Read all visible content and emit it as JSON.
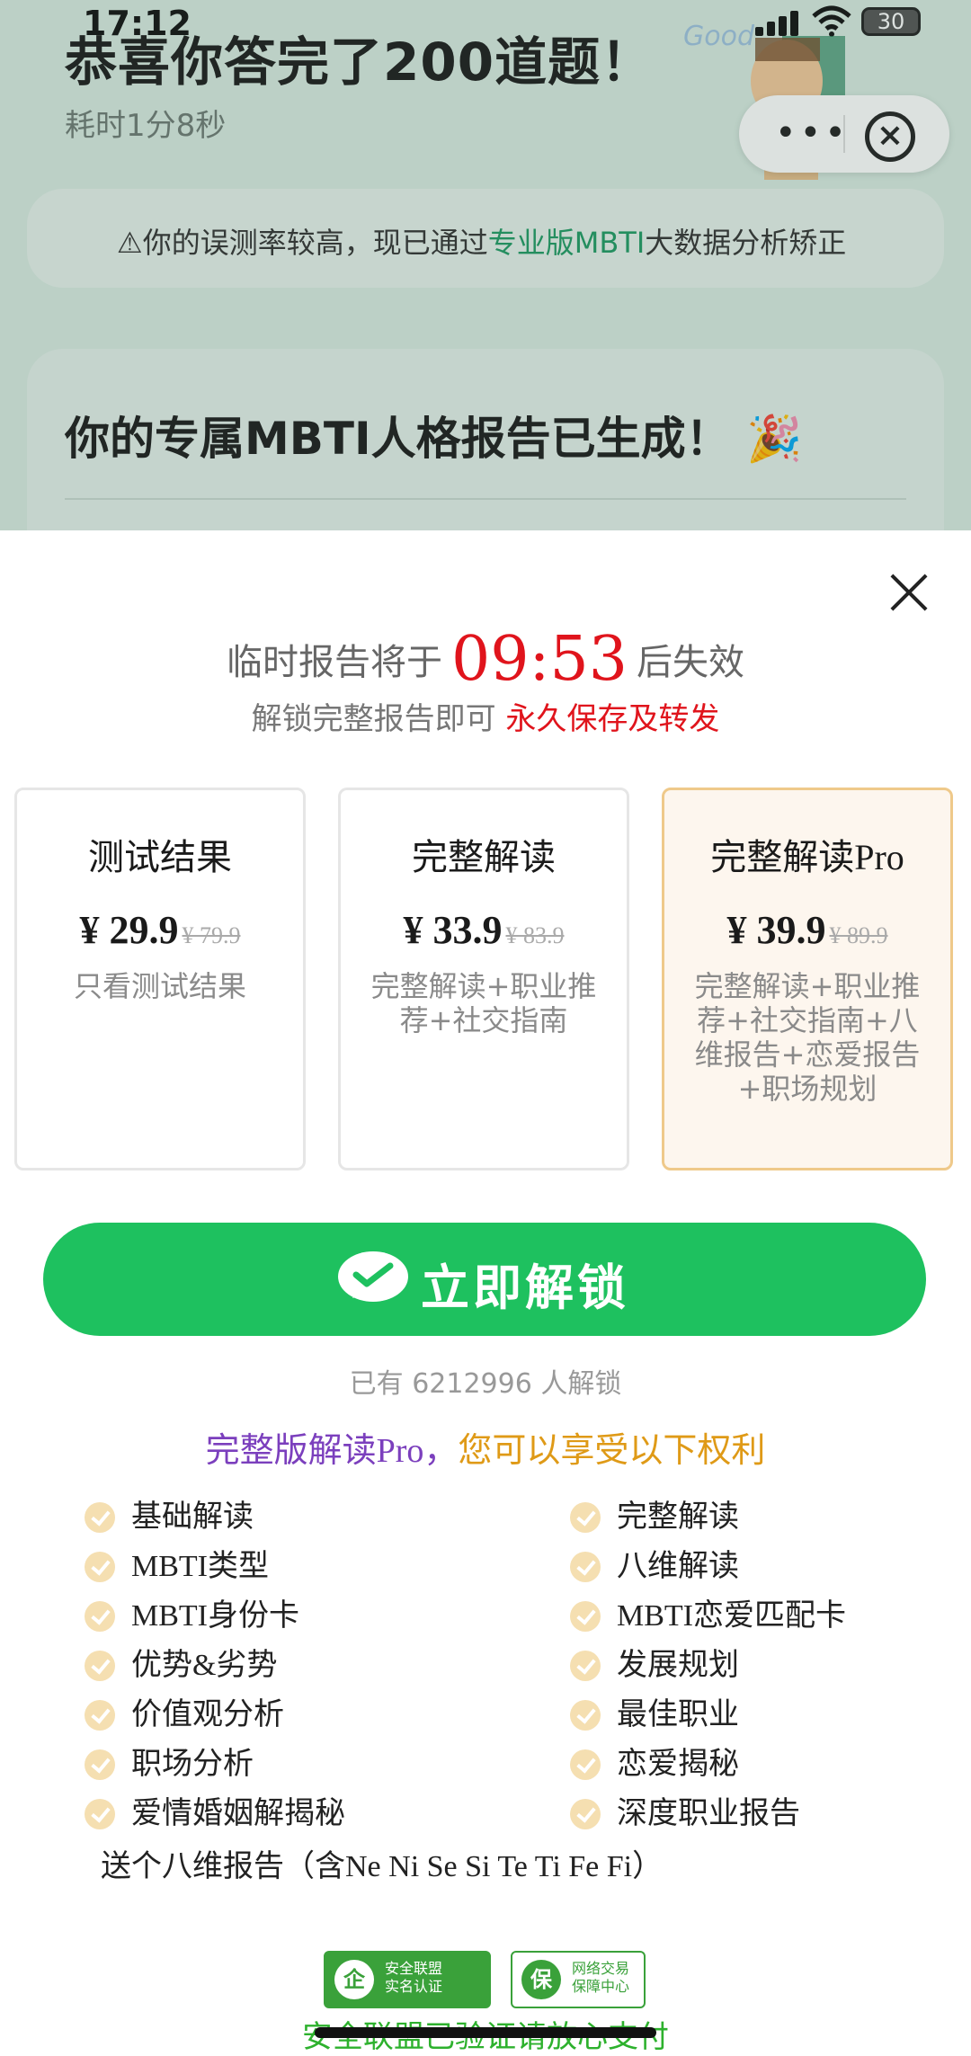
{
  "status_bar": {
    "time": "17:12",
    "battery": "30"
  },
  "background_page": {
    "title": "恭喜你答完了200道题！",
    "subtitle": "耗时1分8秒",
    "warning": {
      "icon": "warning-icon",
      "text_before": "你的误测率较高，现已通过",
      "highlight": "专业版MBTI",
      "text_after": "大数据分析矫正"
    },
    "report_title": "你的专属MBTI人格报告已生成！",
    "mascot_text": "Good"
  },
  "capsule": {
    "more_label": "•••"
  },
  "sheet": {
    "timer_prefix": "临时报告将于",
    "countdown": "09:53",
    "timer_suffix": "后失效",
    "unlock_prefix": "解锁完整报告即可",
    "unlock_highlight": "永久保存及转发",
    "plans": [
      {
        "name": "测试结果",
        "currency": "¥",
        "price": "29.9",
        "old_price": "¥ 79.9",
        "desc": "只看测试结果",
        "selected": false
      },
      {
        "name": "完整解读",
        "currency": "¥",
        "price": "33.9",
        "old_price": "¥ 83.9",
        "desc": "完整解读+职业推荐+社交指南",
        "selected": false
      },
      {
        "name": "完整解读Pro",
        "currency": "¥",
        "price": "39.9",
        "old_price": "¥ 89.9",
        "desc": "完整解读+职业推荐+社交指南+八维报告+恋爱报告+职场规划",
        "selected": true
      }
    ],
    "cta_label": "立即解锁",
    "unlock_count_text": "已有 6212996 人解锁",
    "benefits_title_part1": "完整版解读Pro，",
    "benefits_title_part2": "您可以享受以下权利",
    "benefits_left": [
      "基础解读",
      "MBTI类型",
      "MBTI身份卡",
      "优势&劣势",
      "价值观分析",
      "职场分析",
      "爱情婚姻解揭秘"
    ],
    "benefits_right": [
      "完整解读",
      "八维解读",
      "MBTI恋爱匹配卡",
      "发展规划",
      "最佳职业",
      "恋爱揭秘",
      "深度职业报告"
    ],
    "bonus_text": "送个八维报告（含Ne Ni Se Si Te Ti Fe Fi）",
    "badges": [
      {
        "icon_char": "企",
        "line1": "安全联盟",
        "line2": "实名认证"
      },
      {
        "icon_char": "保",
        "line1": "网络交易",
        "line2": "保障中心"
      }
    ],
    "safe_text": "安全联盟已验证请放心支付"
  },
  "colors": {
    "accent_green": "#1ec15f",
    "countdown_red": "#e0141c",
    "selected_border": "#efc98a",
    "purple": "#7b3fbd",
    "orange": "#df9a17"
  }
}
